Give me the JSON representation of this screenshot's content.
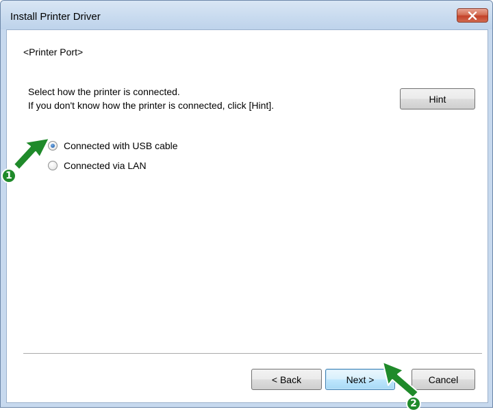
{
  "window": {
    "title": "Install Printer Driver"
  },
  "content": {
    "section_title": "<Printer Port>",
    "instruction_line1": "Select how the printer is connected.",
    "instruction_line2": "If you don't know how the printer is connected, click [Hint].",
    "hint_button": "Hint",
    "options": [
      {
        "label": "Connected with USB cable",
        "selected": true
      },
      {
        "label": "Connected via LAN",
        "selected": false
      }
    ]
  },
  "footer": {
    "back_button": "< Back",
    "next_button": "Next >",
    "cancel_button": "Cancel"
  },
  "annotations": {
    "step1": "1",
    "step2": "2",
    "arrow_color": "#1f8a2a"
  }
}
